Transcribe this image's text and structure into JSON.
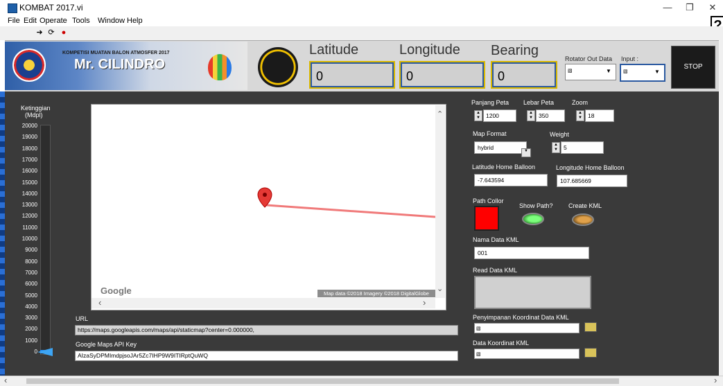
{
  "window": {
    "title": "KOMBAT 2017.vi"
  },
  "menu": [
    "File",
    "Edit",
    "Operate",
    "Tools",
    "Window",
    "Help"
  ],
  "header": {
    "subtitle": "KOMPETISI MUATAN BALON ATMOSFER 2017",
    "team": "Mr. CILINDRO",
    "latitude_label": "Latitude",
    "latitude_value": "0",
    "longitude_label": "Longitude",
    "longitude_value": "0",
    "bearing_label": "Bearing",
    "bearing_value": "0",
    "rotator_label": "Rotator Out Data",
    "input_label": "Input :",
    "stop_label": "STOP"
  },
  "altitude": {
    "label_line1": "Ketinggian",
    "label_line2": "(Mdpl)",
    "ticks": [
      "20000",
      "19000",
      "18000",
      "17000",
      "16000",
      "15000",
      "14000",
      "13000",
      "12000",
      "11000",
      "10000",
      "9000",
      "8000",
      "7000",
      "6000",
      "5000",
      "4000",
      "3000",
      "2000",
      "1000",
      "0"
    ],
    "value": 0
  },
  "map": {
    "google_label": "Google",
    "credit": "Map data ©2018  Imagery ©2018 DigitalGlobe",
    "path_color": "#f07a7a"
  },
  "url": {
    "label": "URL",
    "value": "https://maps.googleapis.com/maps/api/staticmap?center=0.000000,"
  },
  "api_key": {
    "label": "Google Maps API Key",
    "value": "AIzaSyDPMImdpjsoJAr5Zc7IHP9W9ITIRptQuWQ"
  },
  "controls": {
    "panjang_label": "Panjang Peta",
    "panjang_value": "1200",
    "lebar_label": "Lebar Peta",
    "lebar_value": "350",
    "zoom_label": "Zoom",
    "zoom_value": "18",
    "map_format_label": "Map Format",
    "map_format_value": "hybrid",
    "weight_label": "Weight",
    "weight_value": "5",
    "lat_home_label": "Latitude Home Balloon",
    "lat_home_value": "-7.643594",
    "lon_home_label": "Longitude Home Balloon",
    "lon_home_value": "107.685669",
    "path_color_label": "Path Collor",
    "path_color": "#ff0000",
    "show_path_label": "Show Path?",
    "create_kml_label": "Create KML",
    "nama_kml_label": "Nama Data KML",
    "nama_kml_value": "001",
    "read_kml_label": "Read Data KML",
    "penyimpanan_label": "Penyimpanan Koordinat Data KML",
    "data_koordinat_label": "Data Koordinat KML"
  }
}
